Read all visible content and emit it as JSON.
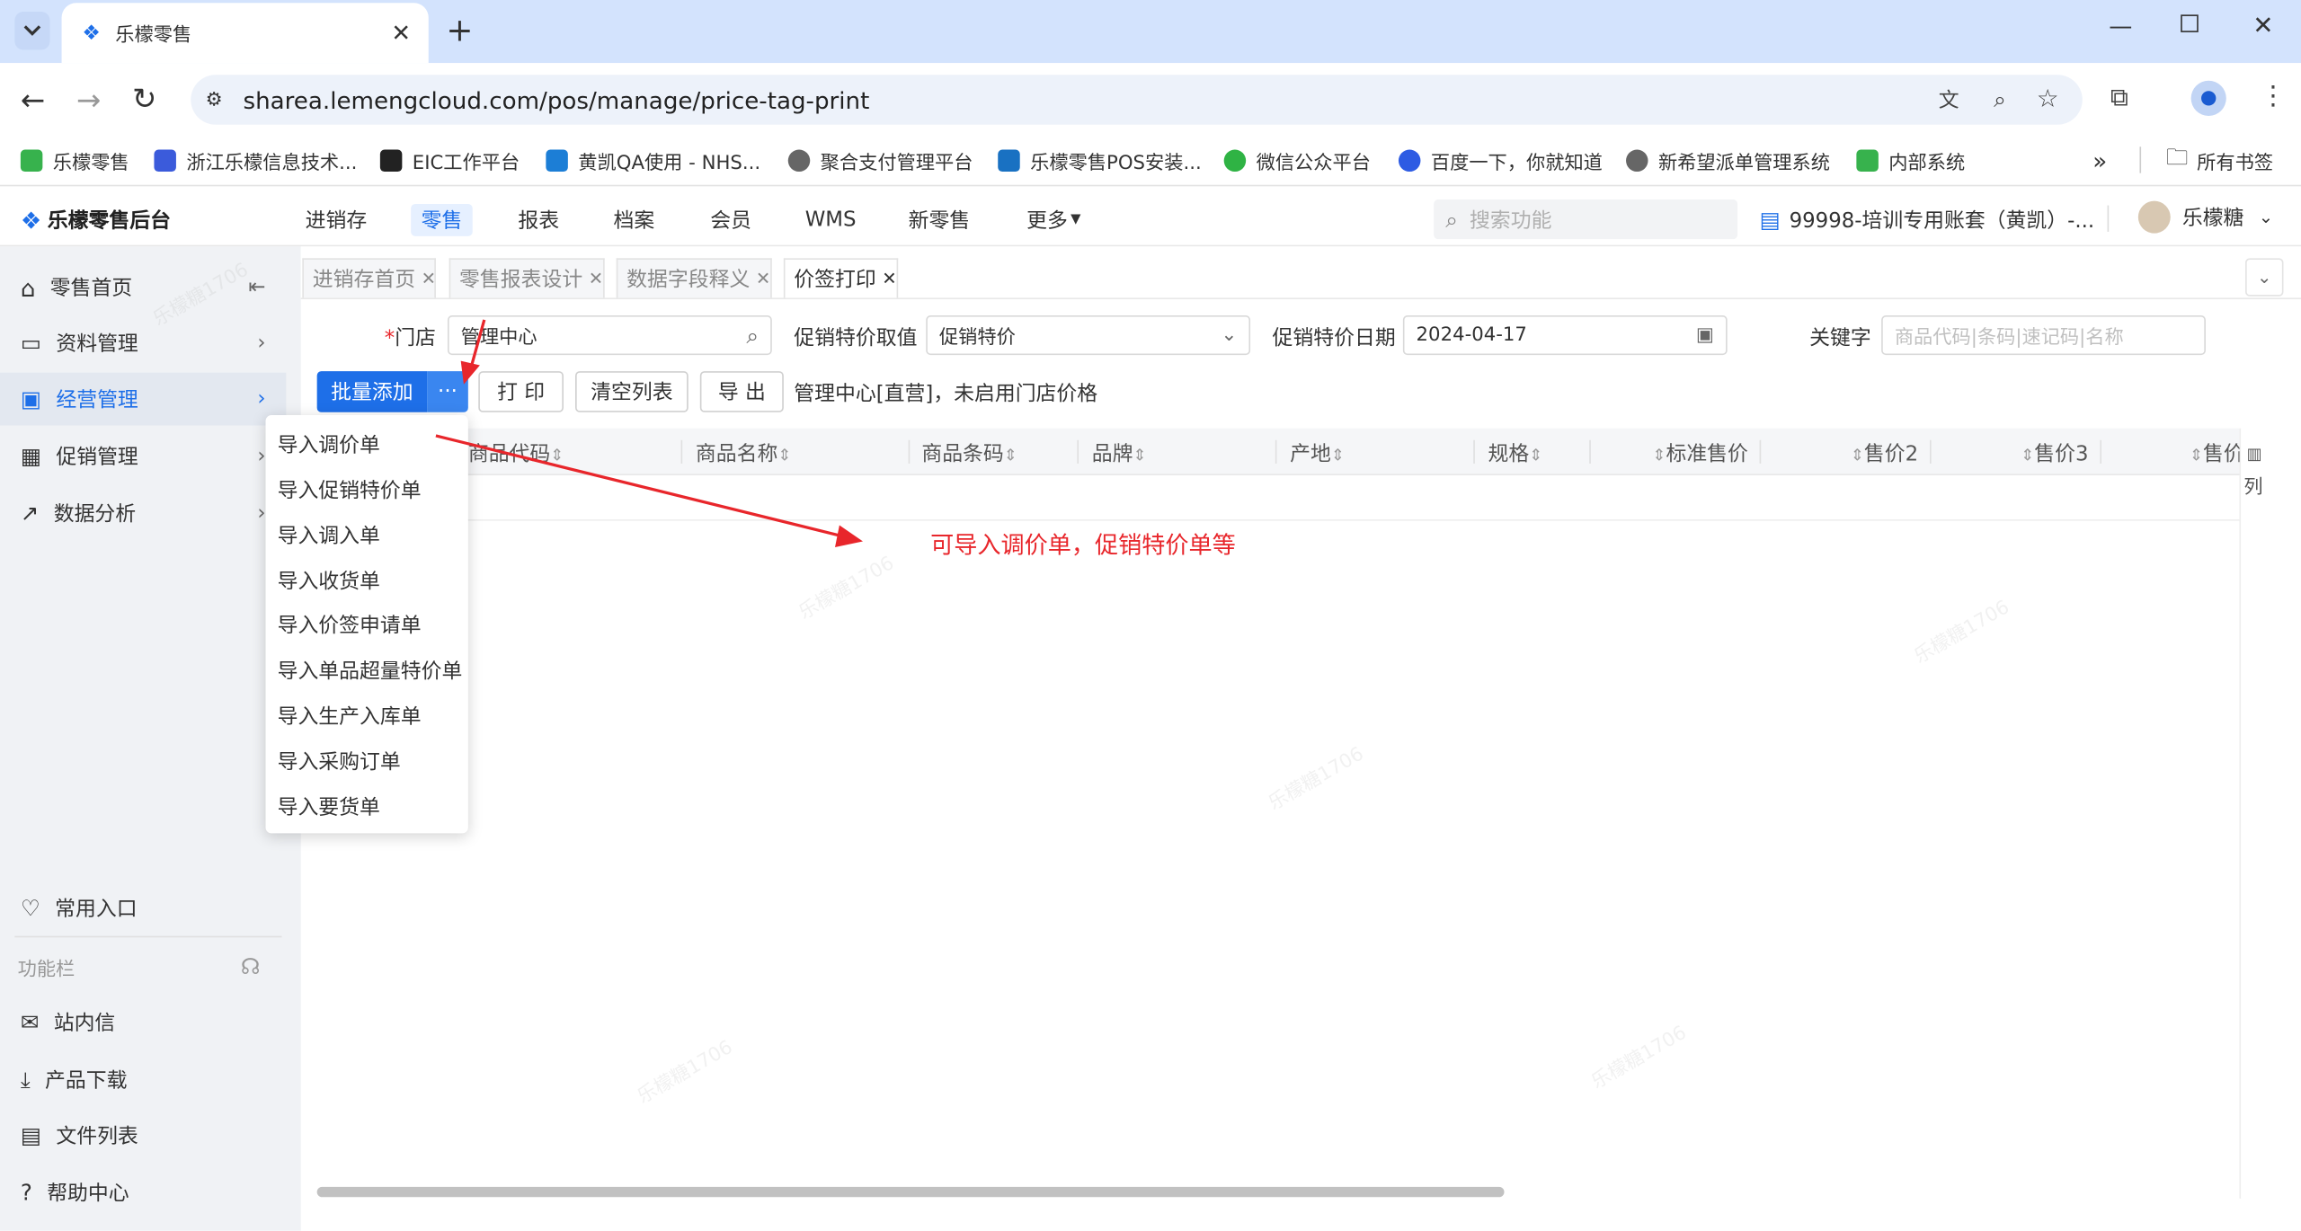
{
  "browser": {
    "tab_title": "乐檬零售",
    "url": "sharea.lemengcloud.com/pos/manage/price-tag-print",
    "new_tab": "+",
    "bookmarks": [
      "乐檬零售",
      "浙江乐檬信息技术...",
      "EIC工作平台",
      "黄凯QA使用 - NHS...",
      "聚合支付管理平台",
      "乐檬零售POS安装...",
      "微信公众平台",
      "百度一下，你就知道",
      "新希望派单管理系统",
      "内部系统"
    ],
    "more_bookmarks": "»",
    "all_bookmarks": "所有书签"
  },
  "app": {
    "logo": "乐檬零售后台",
    "nav": [
      "进销存",
      "零售",
      "报表",
      "档案",
      "会员",
      "WMS",
      "新零售",
      "更多"
    ],
    "active_nav": "零售",
    "search_placeholder": "搜索功能",
    "account": "99998-培训专用账套（黄凯）-...",
    "user": "乐檬糖"
  },
  "sidebar": {
    "items": [
      {
        "label": "零售首页"
      },
      {
        "label": "资料管理"
      },
      {
        "label": "经营管理"
      },
      {
        "label": "促销管理"
      },
      {
        "label": "数据分析"
      }
    ],
    "common": "常用入口",
    "section": "功能栏",
    "tools": [
      "站内信",
      "产品下载",
      "文件列表",
      "帮助中心"
    ]
  },
  "page_tabs": [
    {
      "label": "进销存首页"
    },
    {
      "label": "零售报表设计"
    },
    {
      "label": "数据字段释义"
    },
    {
      "label": "价签打印"
    }
  ],
  "form": {
    "store_label": "门店",
    "store_required": "*",
    "store_value": "管理中心",
    "promo_label": "促销特价取值",
    "promo_value": "促销特价",
    "date_label": "促销特价日期",
    "date_value": "2024-04-17",
    "keyword_label": "关键字",
    "keyword_placeholder": "商品代码|条码|速记码|名称"
  },
  "actions": {
    "batch_add": "批量添加",
    "more": "···",
    "print": "打 印",
    "clear": "清空列表",
    "export": "导 出",
    "status": "管理中心[直营]，未启用门店价格"
  },
  "grid": {
    "columns": [
      "商品代码",
      "商品名称",
      "商品条码",
      "品牌",
      "产地",
      "规格",
      "标准售价",
      "售价2",
      "售价3",
      "售价"
    ],
    "col_settings": "列"
  },
  "dropdown": [
    "导入调价单",
    "导入促销特价单",
    "导入调入单",
    "导入收货单",
    "导入价签申请单",
    "导入单品超量特价单",
    "导入生产入库单",
    "导入采购订单",
    "导入要货单"
  ],
  "annotation": "可导入调价单，促销特价单等",
  "watermark": "乐檬糖1706",
  "colors": {
    "primary": "#1e6fe8",
    "annotation": "#e8262b",
    "sidebar": "#f0f2f5",
    "tabstrip": "#d3e3fd"
  }
}
